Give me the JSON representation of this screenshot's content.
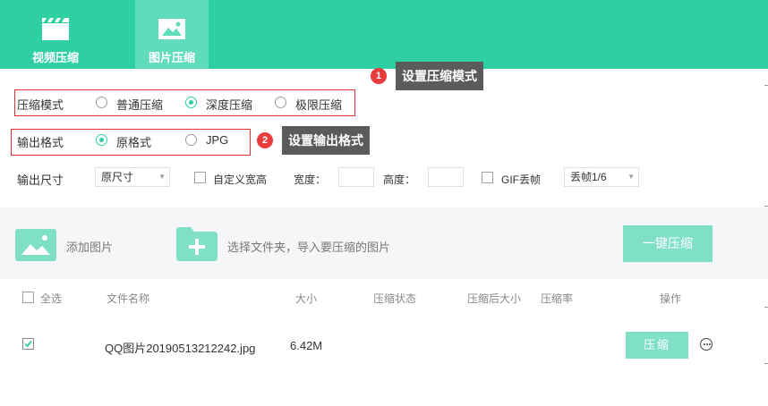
{
  "tabs": [
    {
      "label": "视频压缩",
      "icon": "video-clapper-icon",
      "active": false
    },
    {
      "label": "图片压缩",
      "icon": "image-icon",
      "active": true
    }
  ],
  "compress_mode": {
    "label": "压缩模式",
    "options": [
      "普通压缩",
      "深度压缩",
      "极限压缩"
    ],
    "selected": "深度压缩"
  },
  "output_format": {
    "label": "输出格式",
    "options": [
      "原格式",
      "JPG"
    ],
    "selected": "原格式"
  },
  "callouts": [
    {
      "num": "1",
      "text": "设置压缩模式"
    },
    {
      "num": "2",
      "text": "设置输出格式"
    }
  ],
  "output_size": {
    "label": "输出尺寸",
    "select_value": "原尺寸",
    "custom_label": "自定义宽高",
    "width_label": "宽度：",
    "height_label": "高度：",
    "gif_label": "GIF丢帧",
    "frame_select_value": "丢帧1/6"
  },
  "actions": {
    "add_image": "添加图片",
    "select_folder": "选择文件夹，导入要压缩的图片",
    "compress_all": "一键压缩"
  },
  "table": {
    "headers": {
      "select_all": "全选",
      "filename": "文件名称",
      "size": "大小",
      "status": "压缩状态",
      "after_size": "压缩后大小",
      "ratio": "压缩率",
      "ops": "操作"
    },
    "rows": [
      {
        "checked": true,
        "filename": "QQ图片20190513212242.jpg",
        "size": "6.42M",
        "status": "",
        "after_size": "",
        "ratio": "",
        "button": "压缩"
      }
    ]
  },
  "colors": {
    "accent": "#2ecfa3",
    "accent_light": "#7fe0c6",
    "callout_bg": "#5b5b5b",
    "highlight_red": "#e03131"
  }
}
